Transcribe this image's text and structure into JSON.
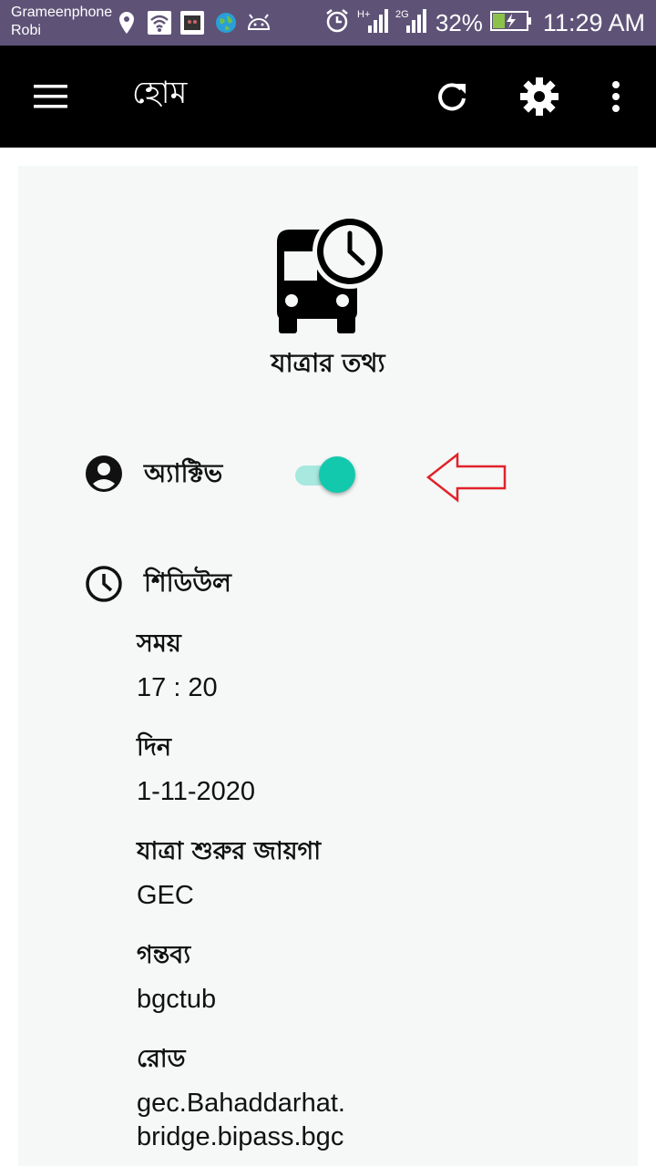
{
  "status_bar": {
    "carrier_1": "Grameenphone",
    "carrier_2": "Robi",
    "icons": [
      "location-icon",
      "wifi-icon",
      "app-icon",
      "globe-icon",
      "android-icon",
      "alarm-icon",
      "signal-h-icon",
      "signal-2g-icon",
      "battery-charging-icon"
    ],
    "battery_percent": "32%",
    "time": "11:29 AM"
  },
  "app_bar": {
    "title": "হোম",
    "actions": [
      "refresh-icon",
      "settings-icon",
      "more-options-icon"
    ]
  },
  "trip": {
    "icon": "bus-clock-icon",
    "title": "যাত্রার তথ্য",
    "active_label": "অ্যাক্টিভ",
    "active_on": true,
    "schedule_label": "শিডিউল",
    "fields": [
      {
        "label": "সময়",
        "value": "17 : 20"
      },
      {
        "label": "দিন",
        "value": "1-11-2020"
      },
      {
        "label": "যাত্রা শুরুর জায়গা",
        "value": "GEC"
      },
      {
        "label": "গন্তব্য",
        "value": "bgctub"
      },
      {
        "label": "রোড",
        "value": "gec.Bahaddarhat.",
        "value_line_2": "bridge.bipass.bgc"
      }
    ]
  },
  "colors": {
    "status_bar_bg": "#5e5377",
    "app_bar_bg": "#000000",
    "card_bg": "#f5f8f7",
    "toggle_thumb": "#13c9ad",
    "toggle_track": "#a7e8df",
    "annotation_arrow": "#e2222a"
  }
}
